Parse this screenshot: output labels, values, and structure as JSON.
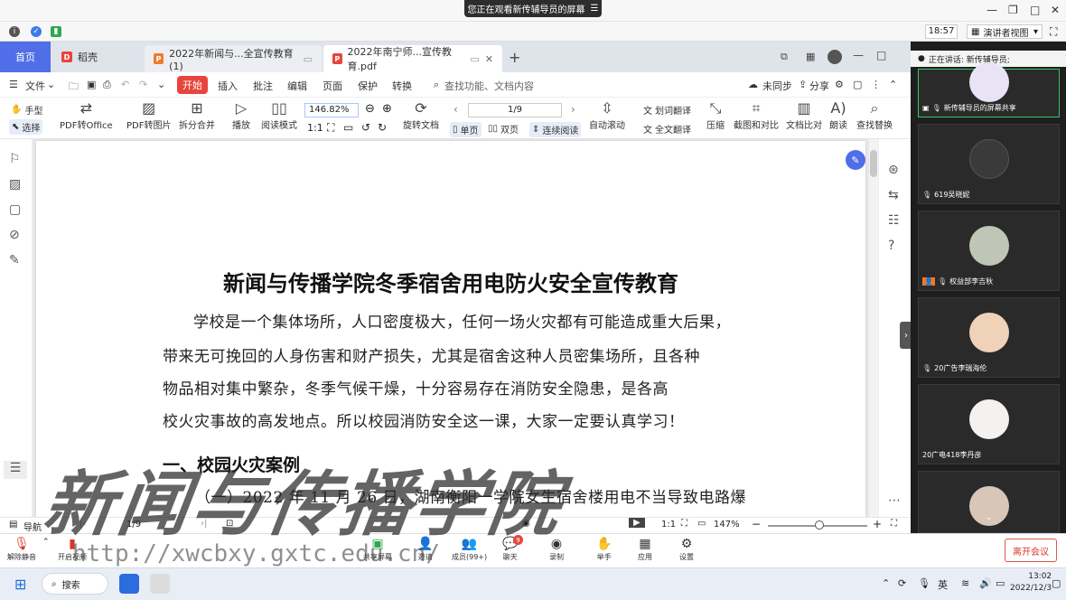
{
  "meeting": {
    "share_banner": "您正在观看新传辅导员的屏幕",
    "time": "18:57",
    "view_mode": "演讲者视图",
    "speaking_label": "正在讲话: 新传辅导员;"
  },
  "wps": {
    "tabs": {
      "home": "首页",
      "daoke": "稻壳",
      "doc1": "2022年新闻与...全宣传教育(1)",
      "pdf": "2022年南宁师...宣传教育.pdf"
    },
    "menu": {
      "file": "文件",
      "start": "开始",
      "insert": "插入",
      "annotate": "批注",
      "edit": "编辑",
      "page": "页面",
      "protect": "保护",
      "convert": "转换",
      "search_placeholder": "查找功能、文档内容",
      "unsynced": "未同步",
      "share": "分享"
    },
    "toolbar": {
      "hand": "手型",
      "select": "选择",
      "pdf_to_office": "PDF转Office",
      "pdf_to_image": "PDF转图片",
      "split_merge": "拆分合并",
      "play": "播放",
      "read_mode": "阅读模式",
      "zoom_value": "146.82%",
      "rotate": "旋转文档",
      "page_value": "1/9",
      "single": "单页",
      "double": "双页",
      "continuous": "连续阅读",
      "auto_scroll": "自动滚动",
      "word_translate": "划词翻译",
      "full_translate": "全文翻译",
      "compress": "压缩",
      "screenshot_compare": "截图和对比",
      "doc_compare": "文档比对",
      "read_aloud": "朗读",
      "find_replace": "查找替换"
    },
    "document": {
      "title": "新闻与传播学院冬季宿舍用电防火安全宣传教育",
      "lines": [
        "学校是一个集体场所，人口密度极大，任何一场火灾都有可能造成重大后果，",
        "带来无可挽回的人身伤害和财产损失，尤其是宿舍这种人员密集场所，且各种",
        "物品相对集中繁杂，冬季气候干燥，十分容易存在消防安全隐患，是各高",
        "校火灾事故的高发地点。所以校园消防安全这一课，大家一定要认真学习！"
      ],
      "section_heading": "一、校园火灾案例",
      "case_line": "（一）2022 年 11 月 26 日，湖南衡阳一学院女生宿舍楼用电不当导致电路爆"
    },
    "status": {
      "nav": "导航",
      "page": "1/9",
      "zoom": "147%"
    }
  },
  "participants": [
    {
      "name": "新传辅导员的屏幕共享",
      "color": "#e9e4f5"
    },
    {
      "name": "619吴晓妮",
      "color": "#3a3a3a"
    },
    {
      "name": "权益部李吉秋",
      "color": "#bfc6b5"
    },
    {
      "name": "20广告李瑞海伦",
      "color": "#f0d2b8"
    },
    {
      "name": "20广电418李丹彦",
      "color": "#f4f1ee"
    },
    {
      "name": "",
      "color": "#d8c6b8"
    }
  ],
  "controls": {
    "unmute": "解除静音",
    "video": "开启视频",
    "share": "共享屏幕",
    "invite": "邀请",
    "members": "成员(99+)",
    "chat": "聊天",
    "chat_badge": "9",
    "record": "录制",
    "raise_hand": "举手",
    "apps": "应用",
    "settings": "设置",
    "leave": "离开会议"
  },
  "taskbar": {
    "search": "搜索",
    "ime": "英",
    "time": "13:02",
    "date": "2022/12/3"
  },
  "watermark": {
    "cn": "新闻与传播学院",
    "url": "http://xwcbxy.gxtc.edu.cn/"
  }
}
